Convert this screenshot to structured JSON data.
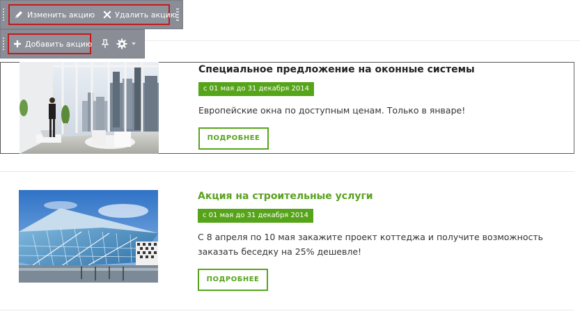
{
  "toolbar": {
    "edit_label": "Изменить акцию",
    "delete_label": "Удалить акцию",
    "add_label": "Добавить акцию"
  },
  "promos": [
    {
      "title": "Специальное предложение на оконные системы",
      "date": "с 01 мая до 31 декабря 2014",
      "text": "Европейские окна по доступным ценам. Только в январе!",
      "button": "ПОДРОБНЕЕ"
    },
    {
      "title": "Акция на строительные услуги",
      "date": "с 01 мая до 31 декабря 2014",
      "text": "С 8 апреля по 10 мая закажите проект коттеджа и получите возможность заказать беседку на 25% дешевле!",
      "button": "ПОДРОБНЕЕ"
    }
  ],
  "colors": {
    "accent": "#56a41a",
    "toolbar_bg": "#8a8d96",
    "highlight": "#c31a1a"
  }
}
